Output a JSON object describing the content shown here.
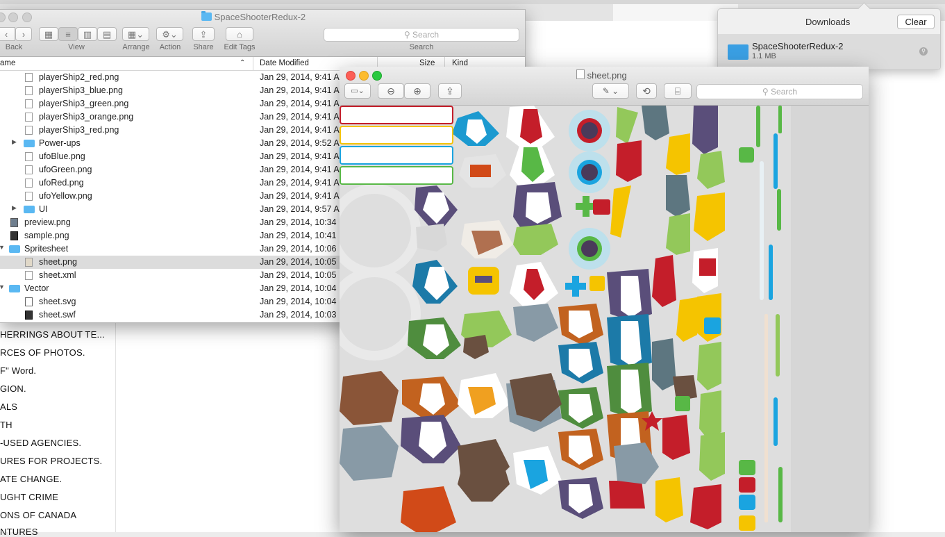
{
  "finder": {
    "title": "SpaceShooterRedux-2",
    "toolbar": {
      "back_label": "Back",
      "view_label": "View",
      "arrange_label": "Arrange",
      "action_label": "Action",
      "share_label": "Share",
      "edit_tags_label": "Edit Tags",
      "search_label": "Search",
      "search_placeholder": "Search"
    },
    "columns": {
      "name": "ame",
      "date_modified": "Date Modified",
      "size": "Size",
      "kind": "Kind"
    },
    "rows": [
      {
        "name": "playerShip2_red.png",
        "date": "Jan 29, 2014, 9:41 A"
      },
      {
        "name": "playerShip3_blue.png",
        "date": "Jan 29, 2014, 9:41 A"
      },
      {
        "name": "playerShip3_green.png",
        "date": "Jan 29, 2014, 9:41 A"
      },
      {
        "name": "playerShip3_orange.png",
        "date": "Jan 29, 2014, 9:41 A"
      },
      {
        "name": "playerShip3_red.png",
        "date": "Jan 29, 2014, 9:41 A"
      },
      {
        "name": "Power-ups",
        "date": "Jan 29, 2014, 9:52 A"
      },
      {
        "name": "ufoBlue.png",
        "date": "Jan 29, 2014, 9:41 A"
      },
      {
        "name": "ufoGreen.png",
        "date": "Jan 29, 2014, 9:41 A"
      },
      {
        "name": "ufoRed.png",
        "date": "Jan 29, 2014, 9:41 A"
      },
      {
        "name": "ufoYellow.png",
        "date": "Jan 29, 2014, 9:41 A"
      },
      {
        "name": "UI",
        "date": "Jan 29, 2014, 9:57 A"
      },
      {
        "name": "preview.png",
        "date": "Jan 29, 2014, 10:34"
      },
      {
        "name": "sample.png",
        "date": "Jan 29, 2014, 10:41"
      },
      {
        "name": "Spritesheet",
        "date": "Jan 29, 2014, 10:06"
      },
      {
        "name": "sheet.png",
        "date": "Jan 29, 2014, 10:05"
      },
      {
        "name": "sheet.xml",
        "date": "Jan 29, 2014, 10:05"
      },
      {
        "name": "Vector",
        "date": "Jan 29, 2014, 10:04"
      },
      {
        "name": "sheet.svg",
        "date": "Jan 29, 2014, 10:04"
      },
      {
        "name": "sheet.swf",
        "date": "Jan 29, 2014, 10:03"
      }
    ]
  },
  "background_links": [
    "HERRINGS ABOUT TE...",
    "RCES OF PHOTOS.",
    "F\" Word.",
    "GION.",
    "ALS",
    "TH",
    "-USED AGENCIES.",
    "URES FOR PROJECTS.",
    "ATE CHANGE.",
    "UGHT CRIME",
    "ONS OF CANADA",
    "NTURES"
  ],
  "preview": {
    "title": "sheet.png",
    "search_placeholder": "Search"
  },
  "downloads": {
    "title": "Downloads",
    "clear_label": "Clear",
    "item_name": "SpaceShooterRedux-2",
    "item_size": "1.1 MB"
  },
  "colors": {
    "accent_blue": "#5ab8f2",
    "red": "#c41e2a",
    "yellow": "#f5c400",
    "orange": "#e0711c",
    "green": "#58b846"
  }
}
